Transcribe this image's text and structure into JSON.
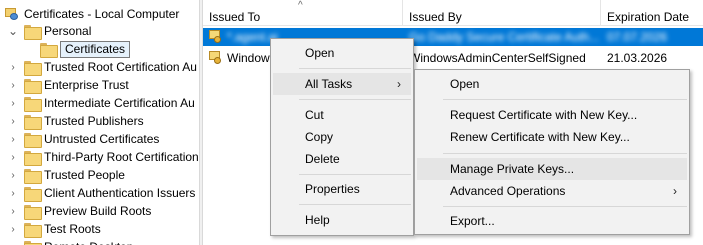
{
  "tree": {
    "root_label": "Certificates - Local Computer",
    "personal_label": "Personal",
    "certificates_label": "Certificates",
    "items": [
      "Trusted Root Certification Au",
      "Enterprise Trust",
      "Intermediate Certification Au",
      "Trusted Publishers",
      "Untrusted Certificates",
      "Third-Party Root Certification",
      "Trusted People",
      "Client Authentication Issuers",
      "Preview Build Roots",
      "Test Roots",
      "Remote Desktop"
    ]
  },
  "list": {
    "columns": [
      "Issued To",
      "Issued By",
      "Expiration Date"
    ],
    "sort_indicator": "^",
    "rows": [
      {
        "issued_to": "*.agent.ai",
        "issued_by": "Go Daddy Secure Certificate Auth...",
        "expiration": "07.07.2026",
        "selected": true
      },
      {
        "issued_to": "Windows",
        "issued_by": "WindowsAdminCenterSelfSigned",
        "expiration": "21.03.2026",
        "selected": false
      }
    ]
  },
  "context_menu": {
    "items": [
      "Open",
      "All Tasks",
      "Cut",
      "Copy",
      "Delete",
      "Properties",
      "Help"
    ],
    "submenu_arrow": "›"
  },
  "all_tasks_submenu": {
    "items": [
      "Open",
      "Request Certificate with New Key...",
      "Renew Certificate with New Key...",
      "Manage Private Keys...",
      "Advanced Operations",
      "Export..."
    ],
    "submenu_arrow": "›"
  },
  "glyphs": {
    "expanded": "⌄",
    "collapsed": "›"
  },
  "colors": {
    "selection": "#0078d7",
    "menu_bg": "#f2f2f2",
    "menu_hover": "#e5e5e5"
  }
}
